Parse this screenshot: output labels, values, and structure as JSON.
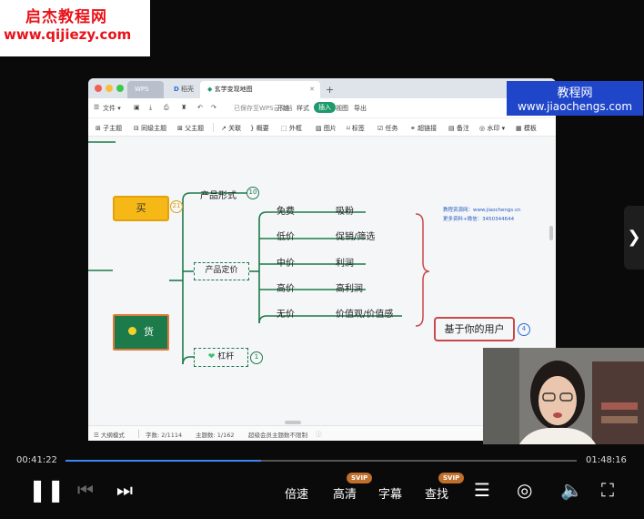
{
  "watermarks": {
    "left_line1": "启杰教程网",
    "left_line2": "www.qijiezy.com",
    "right_line1": "教程网",
    "right_line2": "www.jiaochengs.com"
  },
  "app": {
    "tabs": [
      "WPS",
      "稻壳",
      "玄学变现地图"
    ],
    "toolbar1": {
      "file": "文件",
      "saved": "已保存至WPS云文档",
      "start": "开始",
      "style": "样式",
      "insert": "插入",
      "view": "视图",
      "export": "导出"
    },
    "toolbar2": [
      "子主题",
      "同级主题",
      "父主题",
      "关联",
      "概要",
      "外框",
      "图片",
      "标签",
      "任务",
      "超链接",
      "备注",
      "水印",
      "模板"
    ],
    "status": {
      "mode": "大纲模式",
      "word_count": "字数: 2/1114",
      "topic_count": "主题数: 1/162",
      "member": "超级会员主题数不限制"
    }
  },
  "mindmap": {
    "root": "货",
    "buy": "买",
    "buy_badge": "21",
    "form": "产品形式",
    "form_badge": "10",
    "pricing": "产品定价",
    "leverage": "杠杆",
    "leverage_badge": "1",
    "prices": [
      {
        "tier": "免费",
        "effect": "吸粉"
      },
      {
        "tier": "低价",
        "effect": "促销/筛选"
      },
      {
        "tier": "中价",
        "effect": "利润"
      },
      {
        "tier": "高价",
        "effect": "高利润"
      },
      {
        "tier": "无价",
        "effect": "价值观/价值感"
      }
    ],
    "user_node": "基于你的用户",
    "user_badge": "4",
    "overlay_line1": "教程资源网：www.jiaochengs.cn",
    "overlay_line2": "更多资料+微信：3450344644"
  },
  "player": {
    "current_time": "00:41:22",
    "total_time": "01:48:16",
    "progress": 0.382,
    "speed": "倍速",
    "quality": "高清",
    "subtitle": "字幕",
    "search": "查找",
    "svip": "SVIP"
  }
}
